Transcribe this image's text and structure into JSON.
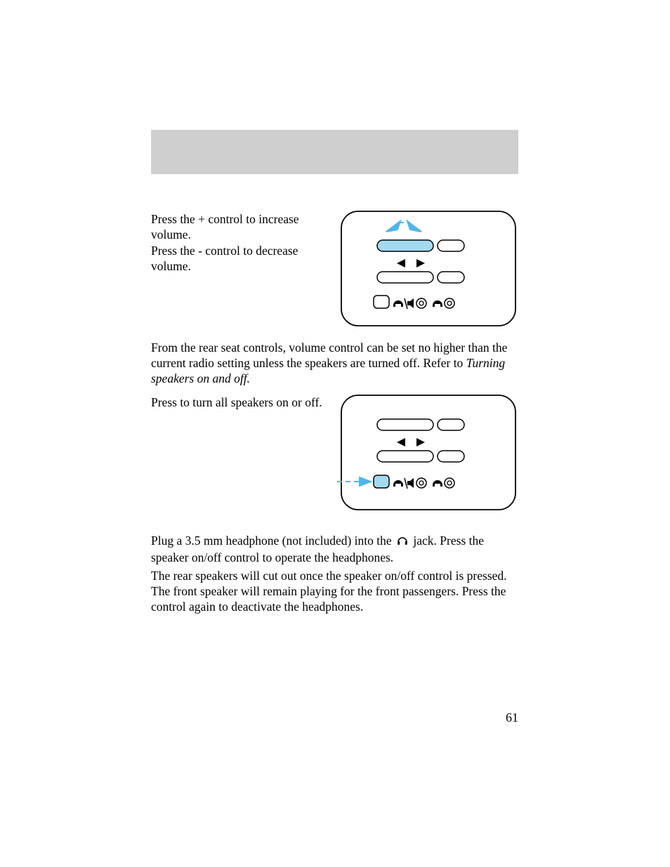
{
  "page_number": "61",
  "paragraphs": {
    "p1": "Press the + control to increase volume.",
    "p2": "Press the - control to decrease volume.",
    "p3a": "From the rear seat controls, volume control can be set no higher than the current radio setting unless the speakers are turned off. Refer to ",
    "p3b": "Turning speakers on and off.",
    "p4": "Press to turn all speakers on or off.",
    "p5a": "Plug a 3.5 mm headphone (not included) into the ",
    "p5b": " jack. Press the speaker on/off control to operate the headphones.",
    "p6": "The rear speakers will cut out once the speaker on/off control is pressed. The front speaker will remain playing for the front passengers. Press the control again to deactivate the headphones."
  },
  "diagram1": {
    "highlight_color": "#50b5e8",
    "highlight_fill": "#a3d9f1"
  },
  "diagram2": {
    "highlight_color": "#50b5e8",
    "highlight_fill": "#a3d9f1"
  }
}
